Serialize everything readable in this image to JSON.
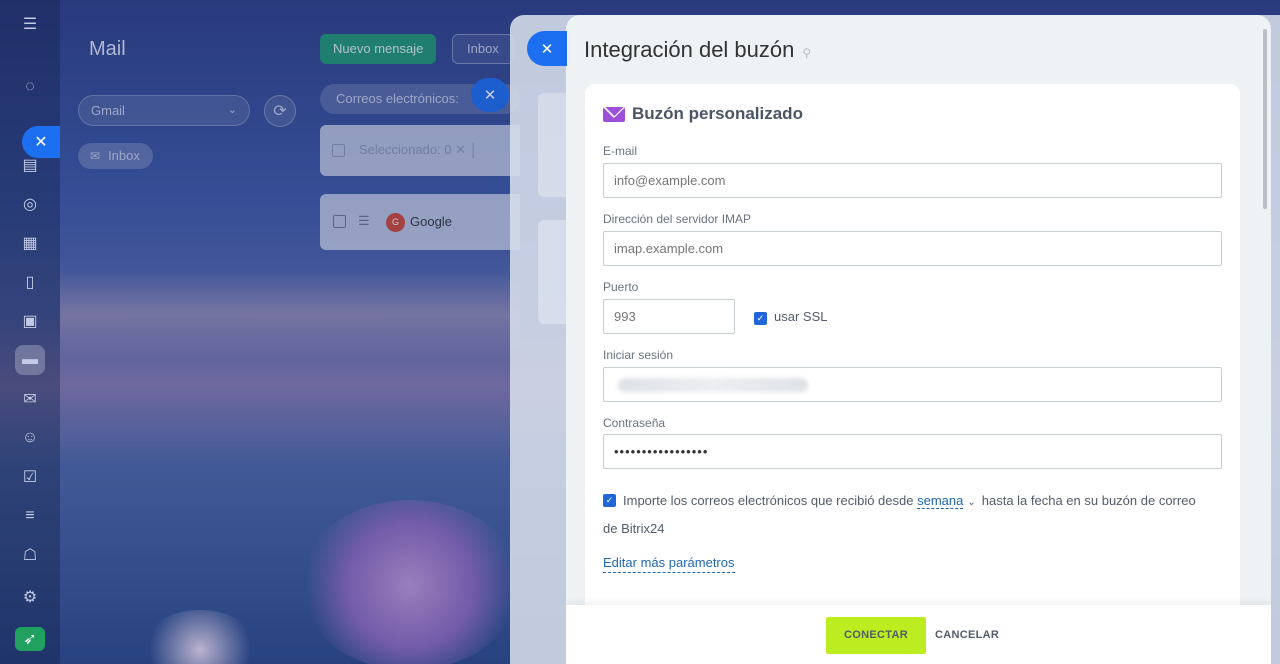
{
  "background": {
    "accent": "#1d6ff2"
  },
  "rail": {
    "icons": [
      "menu-icon",
      "feed-icon",
      "chat-icon",
      "tasks-icon",
      "crm-icon",
      "calendar-icon",
      "docs-icon",
      "boards-icon",
      "drive-icon",
      "mail-icon",
      "contacts-icon",
      "checklist-icon",
      "filter-icon",
      "robot-icon",
      "settings-icon",
      "rocket-icon"
    ]
  },
  "mail": {
    "title": "Mail",
    "new_message": "Nuevo mensaje",
    "inbox_button": "Inbox",
    "account_select": "Gmail",
    "folder_chip": "Inbox",
    "filter_label": "Correos electrónicos:",
    "selected_label": "Seleccionado: 0",
    "row_avatar": "G",
    "row_from": "Google"
  },
  "slider": {
    "title": "Integración del buzón",
    "card_title": "Buzón personalizado",
    "email_label": "E-mail",
    "email_placeholder": "info@example.com",
    "imap_label": "Dirección del servidor IMAP",
    "imap_placeholder": "imap.example.com",
    "port_label": "Puerto",
    "port_placeholder": "993",
    "ssl_label": "usar SSL",
    "ssl_checked": true,
    "login_label": "Iniciar sesión",
    "password_label": "Contraseña",
    "password_value": "•••••••••••••••••",
    "import_text_before": "Importe los correos electrónicos que recibió desde",
    "import_period": "semana",
    "import_text_after": "hasta la fecha en su buzón de correo de Bitrix24",
    "import_checked": true,
    "more_params": "Editar más parámetros",
    "connect": "CONECTAR",
    "cancel": "CANCELAR",
    "connect_color": "#bbed21"
  }
}
